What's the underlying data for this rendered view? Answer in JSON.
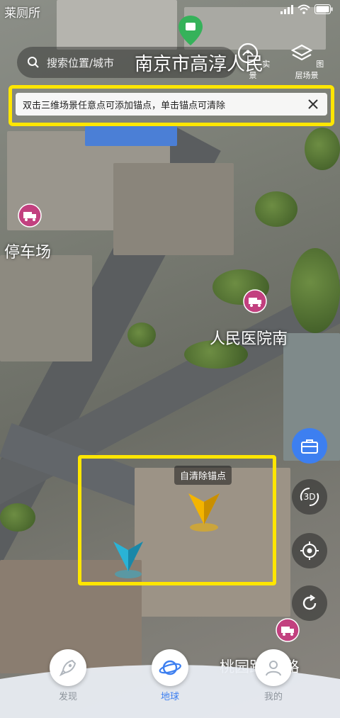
{
  "status_bar": {
    "left_text": "莱厕所",
    "battery": "full"
  },
  "search": {
    "placeholder": "搜索位置/城市",
    "icon": "search-icon"
  },
  "location_title": "南京市高淳人民",
  "top_buttons": [
    {
      "label": "实景",
      "icon": "layers-icon"
    },
    {
      "label": "图层场景",
      "icon": "stack-icon"
    }
  ],
  "notice": {
    "text": "双击三维场景任意点可添加锚点，单击锚点可清除",
    "close_icon": "close-icon"
  },
  "poi_labels": [
    {
      "text": "停车场",
      "icon": "truck-pin-icon"
    },
    {
      "text": "人民医院南",
      "icon": "truck-pin-icon"
    },
    {
      "text": "桃园路-道路",
      "icon": "truck-pin-icon"
    }
  ],
  "anchor": {
    "tip": "自清除锚点",
    "colors": {
      "anchor_1": "#f3b400",
      "anchor_2": "#2ab3d6"
    }
  },
  "controls": [
    {
      "name": "toolbox",
      "icon": "toolbox-icon"
    },
    {
      "name": "3d",
      "label": "3D",
      "icon": "rotate-3d-icon"
    },
    {
      "name": "locate",
      "icon": "crosshair-icon"
    },
    {
      "name": "refresh",
      "icon": "refresh-icon"
    }
  ],
  "tabs": [
    {
      "label": "发现",
      "icon": "rocket-icon",
      "active": false
    },
    {
      "label": "地球",
      "icon": "planet-icon",
      "active": true
    },
    {
      "label": "我的",
      "icon": "user-icon",
      "active": false
    }
  ],
  "colors": {
    "highlight_frame": "#ffe600",
    "accent": "#3d7ff0",
    "pin": "#c2407f"
  }
}
